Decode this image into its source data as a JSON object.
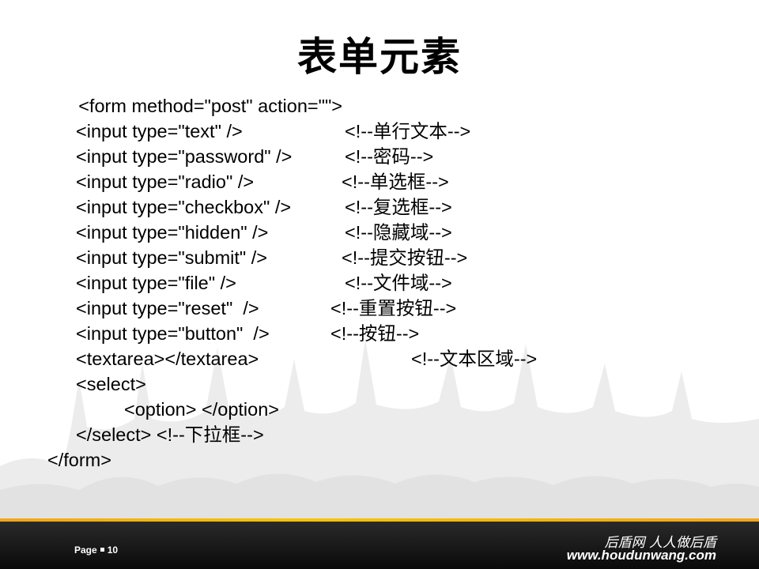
{
  "slide": {
    "title": "表单元素",
    "code_lines": [
      {
        "code": "<form method=\"post\" action=\"\">",
        "comment": ""
      },
      {
        "code": "<input type=\"text\" />",
        "comment": "<!--单行文本-->"
      },
      {
        "code": "<input type=\"password\" />",
        "comment": "<!--密码-->"
      },
      {
        "code": "<input type=\"radio\" />",
        "comment": "<!--单选框-->"
      },
      {
        "code": "<input type=\"checkbox\" />",
        "comment": "<!--复选框-->"
      },
      {
        "code": "<input type=\"hidden\" />",
        "comment": "<!--隐藏域-->"
      },
      {
        "code": "<input type=\"submit\" />",
        "comment": "<!--提交按钮-->"
      },
      {
        "code": "<input type=\"file\" />",
        "comment": "<!--文件域-->"
      },
      {
        "code": "<input type=\"reset\"  />",
        "comment": "<!--重置按钮-->"
      },
      {
        "code": "<input type=\"button\"  />",
        "comment": "<!--按钮-->"
      },
      {
        "code": "<textarea></textarea>",
        "comment": "<!--文本区域-->"
      },
      {
        "code": "<select>",
        "comment": ""
      },
      {
        "code": "<option> </option>",
        "comment": ""
      },
      {
        "code": "</select> <!--下拉框-->",
        "comment": ""
      },
      {
        "code": "</form>",
        "comment": ""
      }
    ]
  },
  "footer": {
    "page_label": "Page",
    "page_number": "10",
    "brand_cn": "后盾网 人人做后盾",
    "brand_url": "www.houdunwang.com"
  },
  "colors": {
    "footer_bg": "#111111",
    "footer_stripe": "#f5b800",
    "text": "#000000"
  }
}
